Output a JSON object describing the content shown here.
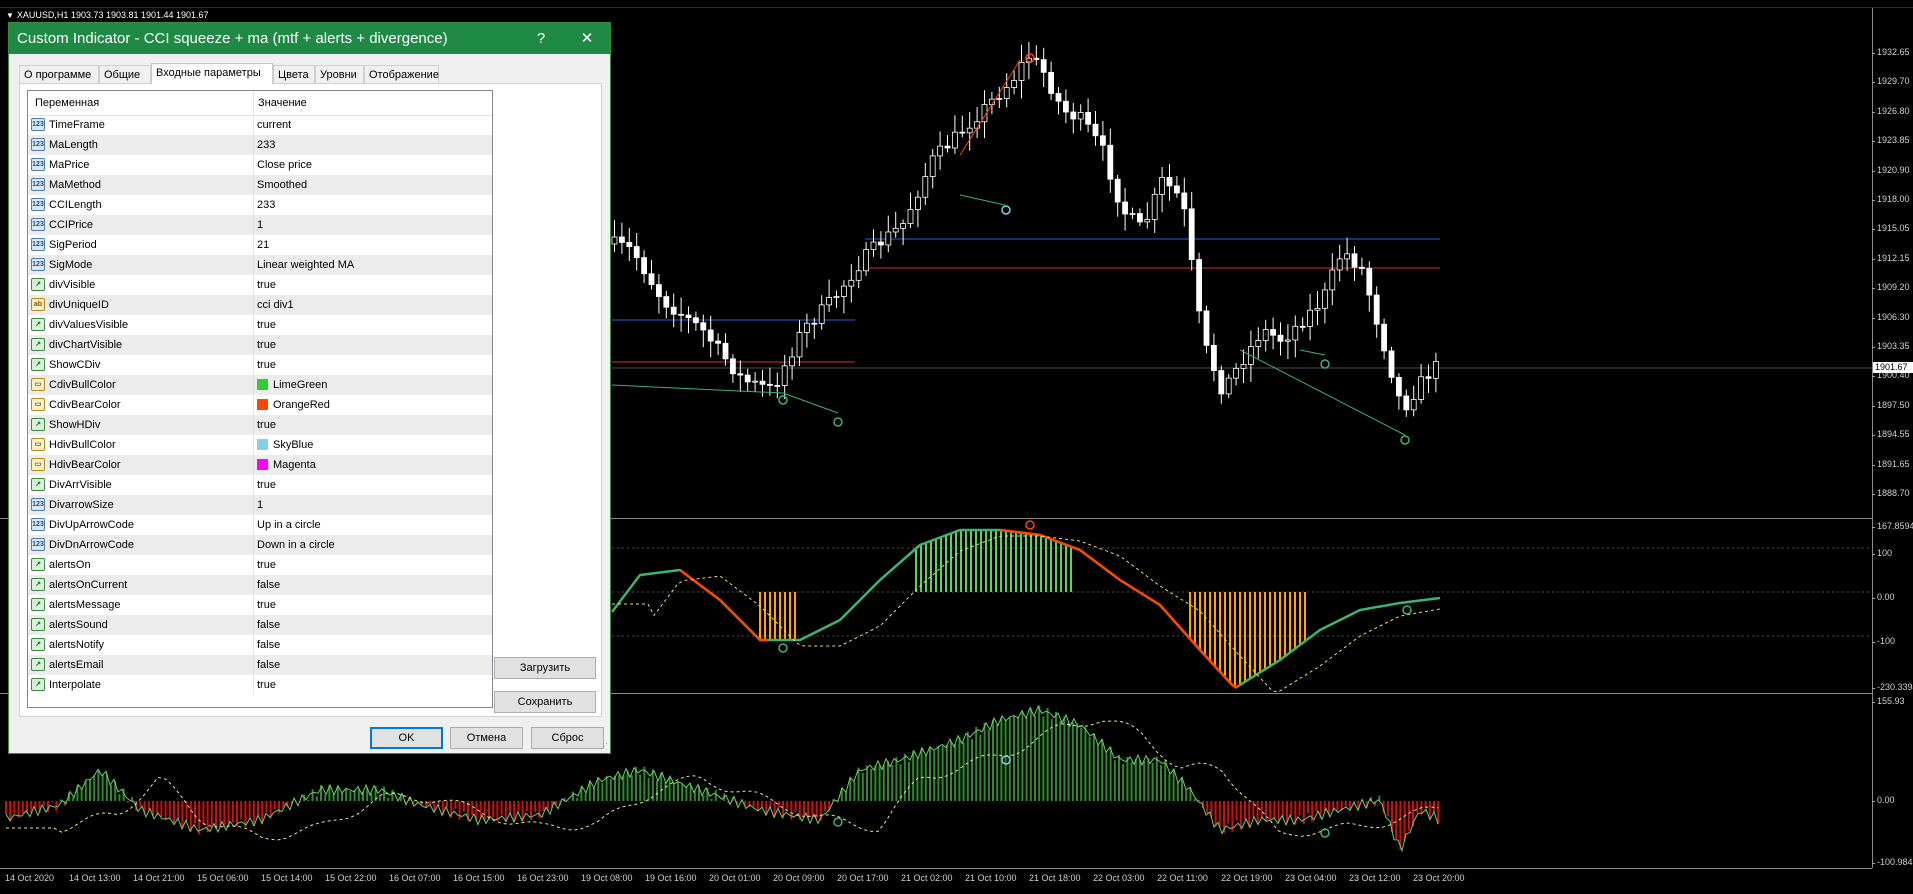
{
  "chart": {
    "symbol_line": "XAUUSD,H1  1903.73 1903.81 1901.44 1901.67",
    "current_price": "1901.67",
    "price_axis_main": [
      "1932.65",
      "1929.70",
      "1926.80",
      "1923.85",
      "1920.90",
      "1918.00",
      "1915.05",
      "1912.15",
      "1909.20",
      "1906.30",
      "1903.35",
      "1900.40",
      "1897.50",
      "1894.55",
      "1891.65",
      "1888.70"
    ],
    "price_axis_cci": [
      "167.8594",
      "100",
      "0.00",
      "-100",
      "-230.3394"
    ],
    "price_axis_hist": [
      "155.93",
      "0.00",
      "-100.984"
    ],
    "time_axis": [
      "14 Oct 2020",
      "14 Oct 13:00",
      "14 Oct 21:00",
      "15 Oct 06:00",
      "15 Oct 14:00",
      "15 Oct 22:00",
      "16 Oct 07:00",
      "16 Oct 15:00",
      "16 Oct 23:00",
      "19 Oct 08:00",
      "19 Oct 16:00",
      "20 Oct 01:00",
      "20 Oct 09:00",
      "20 Oct 17:00",
      "21 Oct 02:00",
      "21 Oct 10:00",
      "21 Oct 18:00",
      "22 Oct 03:00",
      "22 Oct 11:00",
      "22 Oct 19:00",
      "23 Oct 04:00",
      "23 Oct 12:00",
      "23 Oct 20:00"
    ],
    "colors": {
      "bull": "#3cb371",
      "bear": "#ff4500",
      "blue_line": "#3060d0",
      "red_line": "#d03030",
      "hist_green": "#2e8b2e",
      "hist_red": "#d01010",
      "orange": "#ffa500"
    }
  },
  "dialog": {
    "title": "Custom Indicator - CCI squeeze + ma (mtf + alerts + divergence)",
    "help_glyph": "?",
    "close_glyph": "✕",
    "tabs": [
      "О программе",
      "Общие",
      "Входные параметры",
      "Цвета",
      "Уровни",
      "Отображение"
    ],
    "active_tab": 2,
    "col_variable": "Переменная",
    "col_value": "Значение",
    "params": [
      {
        "icon": "123",
        "name": "TimeFrame",
        "value": "current"
      },
      {
        "icon": "123",
        "name": "MaLength",
        "value": "233"
      },
      {
        "icon": "123",
        "name": "MaPrice",
        "value": "Close price"
      },
      {
        "icon": "123",
        "name": "MaMethod",
        "value": "Smoothed"
      },
      {
        "icon": "123",
        "name": "CCILength",
        "value": "233"
      },
      {
        "icon": "123",
        "name": "CCIPrice",
        "value": "1"
      },
      {
        "icon": "123",
        "name": "SigPeriod",
        "value": "21"
      },
      {
        "icon": "123",
        "name": "SigMode",
        "value": "Linear weighted MA"
      },
      {
        "icon": "bool",
        "name": "divVisible",
        "value": "true"
      },
      {
        "icon": "ab",
        "name": "divUniqueID",
        "value": "cci div1"
      },
      {
        "icon": "bool",
        "name": "divValuesVisible",
        "value": "true"
      },
      {
        "icon": "bool",
        "name": "divChartVisible",
        "value": "true"
      },
      {
        "icon": "bool",
        "name": "ShowCDiv",
        "value": "true"
      },
      {
        "icon": "color",
        "name": "CdivBullColor",
        "value": "LimeGreen",
        "swatch": "#32cd32"
      },
      {
        "icon": "color",
        "name": "CdivBearColor",
        "value": "OrangeRed",
        "swatch": "#ff4500"
      },
      {
        "icon": "bool",
        "name": "ShowHDiv",
        "value": "true"
      },
      {
        "icon": "color",
        "name": "HdivBullColor",
        "value": "SkyBlue",
        "swatch": "#87ceeb"
      },
      {
        "icon": "color",
        "name": "HdivBearColor",
        "value": "Magenta",
        "swatch": "#ff00ff"
      },
      {
        "icon": "bool",
        "name": "DivArrVisible",
        "value": "true"
      },
      {
        "icon": "123",
        "name": "DivarrowSize",
        "value": "1"
      },
      {
        "icon": "123",
        "name": "DivUpArrowCode",
        "value": "Up in a circle"
      },
      {
        "icon": "123",
        "name": "DivDnArrowCode",
        "value": "Down in a circle"
      },
      {
        "icon": "bool",
        "name": "alertsOn",
        "value": "true"
      },
      {
        "icon": "bool",
        "name": "alertsOnCurrent",
        "value": "false"
      },
      {
        "icon": "bool",
        "name": "alertsMessage",
        "value": "true"
      },
      {
        "icon": "bool",
        "name": "alertsSound",
        "value": "false"
      },
      {
        "icon": "bool",
        "name": "alertsNotify",
        "value": "false"
      },
      {
        "icon": "bool",
        "name": "alertsEmail",
        "value": "false"
      },
      {
        "icon": "bool",
        "name": "Interpolate",
        "value": "true"
      }
    ],
    "load_button": "Загрузить",
    "save_button": "Сохранить",
    "ok_button": "OK",
    "cancel_button": "Отмена",
    "reset_button": "Сброс"
  }
}
